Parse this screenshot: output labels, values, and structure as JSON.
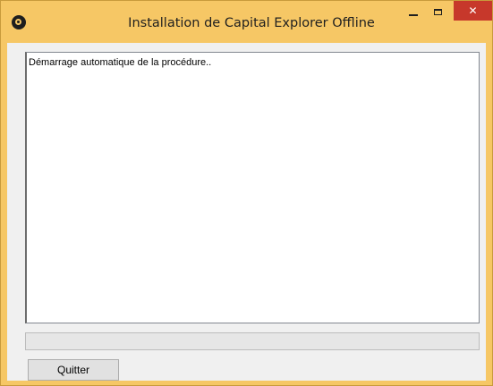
{
  "window": {
    "title": "Installation de Capital Explorer Offline",
    "controls": {
      "minimize": "–",
      "maximize": "",
      "close": "✕"
    }
  },
  "log": {
    "text": "Démarrage automatique de la procédure.."
  },
  "progress": {
    "fraction": 0
  },
  "actions": {
    "quit_label": "Quitter"
  },
  "colors": {
    "titlebar": "#f6c765",
    "close_button": "#c7382b",
    "client_background": "#f0f0f0"
  },
  "icons": {
    "app": "app-logo-icon",
    "minimize": "minimize-icon",
    "maximize": "maximize-icon",
    "close": "close-icon"
  }
}
